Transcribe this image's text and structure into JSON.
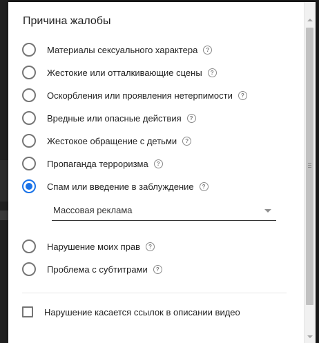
{
  "dialog": {
    "title": "Причина жалобы",
    "options": [
      {
        "label": "Материалы сексуального характера",
        "checked": false
      },
      {
        "label": "Жестокие или отталкивающие сцены",
        "checked": false
      },
      {
        "label": "Оскорбления или проявления нетерпимости",
        "checked": false
      },
      {
        "label": "Вредные или опасные действия",
        "checked": false
      },
      {
        "label": "Жестокое обращение с детьми",
        "checked": false
      },
      {
        "label": "Пропаганда терроризма",
        "checked": false
      },
      {
        "label": "Спам или введение в заблуждение",
        "checked": true
      },
      {
        "label": "Нарушение моих прав",
        "checked": false
      },
      {
        "label": "Проблема с субтитрами",
        "checked": false
      }
    ],
    "help_glyph": "?",
    "subreason_select": {
      "selected": "Массовая реклама"
    },
    "checkbox": {
      "label": "Нарушение касается ссылок в описании видео",
      "checked": false
    },
    "accent_color": "#1a73e8"
  }
}
